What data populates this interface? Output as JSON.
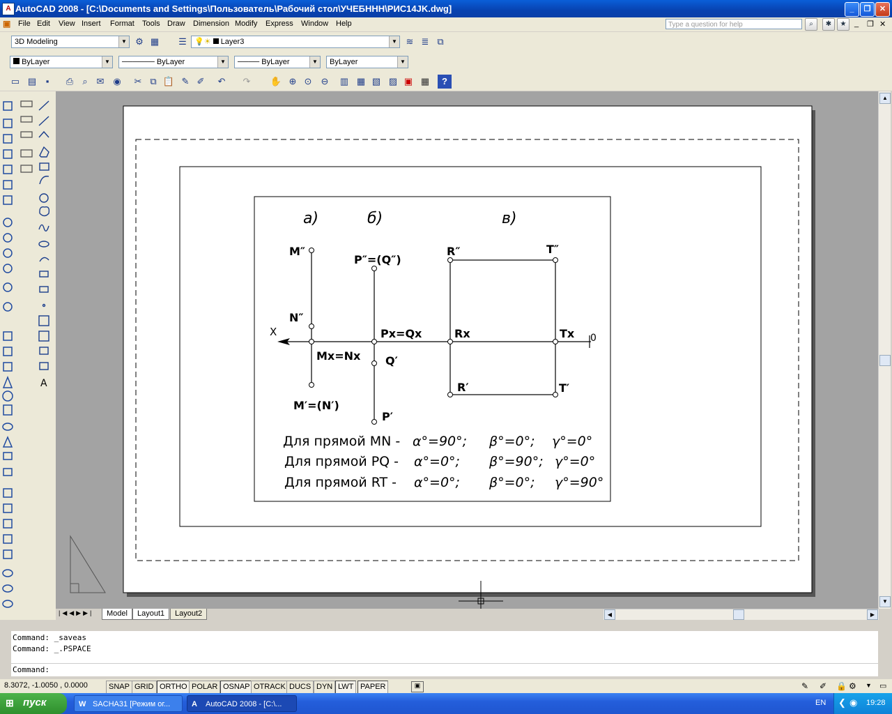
{
  "window": {
    "title": "AutoCAD 2008 - [C:\\Documents and Settings\\Пользователь\\Рабочий стол\\УЧЕБННН\\РИС14JK.dwg]"
  },
  "menu": [
    "File",
    "Edit",
    "View",
    "Insert",
    "Format",
    "Tools",
    "Draw",
    "Dimension",
    "Modify",
    "Express",
    "Window",
    "Help"
  ],
  "help_search": {
    "placeholder": "Type a question for help"
  },
  "toolbar1": {
    "workspace": "3D Modeling",
    "layer": "Layer3"
  },
  "properties": {
    "color": "ByLayer",
    "linetype": "ByLayer",
    "lineweight": "ByLayer",
    "plotstyle": "ByLayer"
  },
  "drawing": {
    "headers": {
      "a": "а)",
      "b": "б)",
      "v": "в)"
    },
    "axis": {
      "x": "X",
      "zero": "0"
    },
    "labels": {
      "m2": "M″",
      "n2": "N″",
      "mxnx": "Mx=Nx",
      "m1n1": "M′=(N′)",
      "p2q2": "P″=(Q″)",
      "pxqx": "Px=Qx",
      "q1": "Q′",
      "p1": "P′",
      "r2": "R″",
      "t2": "T″",
      "rx": "Rx",
      "tx": "Tx",
      "r1": "R′",
      "t1": "T′"
    },
    "lines": [
      {
        "prefix": "Для прямой MN  -",
        "a": "α°=90°;",
        "b": "β°=0°;",
        "g": "γ°=0°"
      },
      {
        "prefix": "Для прямой PQ  -",
        "a": "α°=0°;",
        "b": "β°=90°;",
        "g": "γ°=0°"
      },
      {
        "prefix": "Для прямой RT  -",
        "a": "α°=0°;",
        "b": "β°=0°;",
        "g": "γ°=90°"
      }
    ]
  },
  "layout_tabs": [
    "Model",
    "Layout1",
    "Layout2"
  ],
  "command": {
    "line1": "Command: _saveas",
    "line2": "Command: _.PSPACE",
    "prompt": "Command:"
  },
  "status": {
    "coords": "8.3072, -1.0050 , 0.0000",
    "buttons": [
      "SNAP",
      "GRID",
      "ORTHO",
      "POLAR",
      "OSNAP",
      "OTRACK",
      "DUCS",
      "DYN",
      "LWT",
      "PAPER"
    ]
  },
  "taskbar": {
    "start": "пуск",
    "tasks": [
      "SACHA31 [Режим ог...",
      "AutoCAD 2008 - [C:\\..."
    ],
    "lang": "EN",
    "time": "19:28"
  }
}
